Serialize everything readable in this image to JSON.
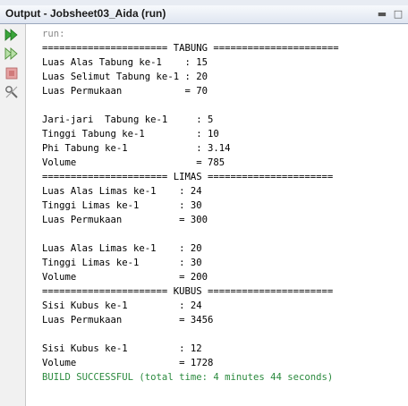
{
  "window": {
    "title": "Output - Jobsheet03_Aida (run)"
  },
  "toolbar": {
    "items": [
      {
        "name": "rerun",
        "icon": "double-play-icon",
        "color": "#2e9c2e"
      },
      {
        "name": "rerun-with-options",
        "icon": "double-play-outline-icon",
        "color": "#6aa84f"
      },
      {
        "name": "stop",
        "icon": "stop-square-icon",
        "color": "#d9534f"
      },
      {
        "name": "settings",
        "icon": "tools-icon",
        "color": "#6a6a6a"
      }
    ]
  },
  "output": {
    "lines": [
      {
        "text": "run:",
        "style": "gray"
      },
      {
        "text": "====================== TABUNG ======================",
        "style": "normal"
      },
      {
        "text": "Luas Alas Tabung ke-1    : 15",
        "style": "normal"
      },
      {
        "text": "Luas Selimut Tabung ke-1 : 20",
        "style": "normal"
      },
      {
        "text": "Luas Permukaan           = 70",
        "style": "normal"
      },
      {
        "text": "",
        "style": "normal"
      },
      {
        "text": "Jari-jari  Tabung ke-1     : 5",
        "style": "normal"
      },
      {
        "text": "Tinggi Tabung ke-1         : 10",
        "style": "normal"
      },
      {
        "text": "Phi Tabung ke-1            : 3.14",
        "style": "normal"
      },
      {
        "text": "Volume                     = 785",
        "style": "normal"
      },
      {
        "text": "====================== LIMAS ======================",
        "style": "normal"
      },
      {
        "text": "Luas Alas Limas ke-1    : 24",
        "style": "normal"
      },
      {
        "text": "Tinggi Limas ke-1       : 30",
        "style": "normal"
      },
      {
        "text": "Luas Permukaan          = 300",
        "style": "normal"
      },
      {
        "text": "",
        "style": "normal"
      },
      {
        "text": "Luas Alas Limas ke-1    : 20",
        "style": "normal"
      },
      {
        "text": "Tinggi Limas ke-1       : 30",
        "style": "normal"
      },
      {
        "text": "Volume                  = 200",
        "style": "normal"
      },
      {
        "text": "====================== KUBUS ======================",
        "style": "normal"
      },
      {
        "text": "Sisi Kubus ke-1         : 24",
        "style": "normal"
      },
      {
        "text": "Luas Permukaan          = 3456",
        "style": "normal"
      },
      {
        "text": "",
        "style": "normal"
      },
      {
        "text": "Sisi Kubus ke-1         : 12",
        "style": "normal"
      },
      {
        "text": "Volume                  = 1728",
        "style": "normal"
      },
      {
        "text": "BUILD SUCCESSFUL (total time: 4 minutes 44 seconds)",
        "style": "green"
      }
    ]
  }
}
